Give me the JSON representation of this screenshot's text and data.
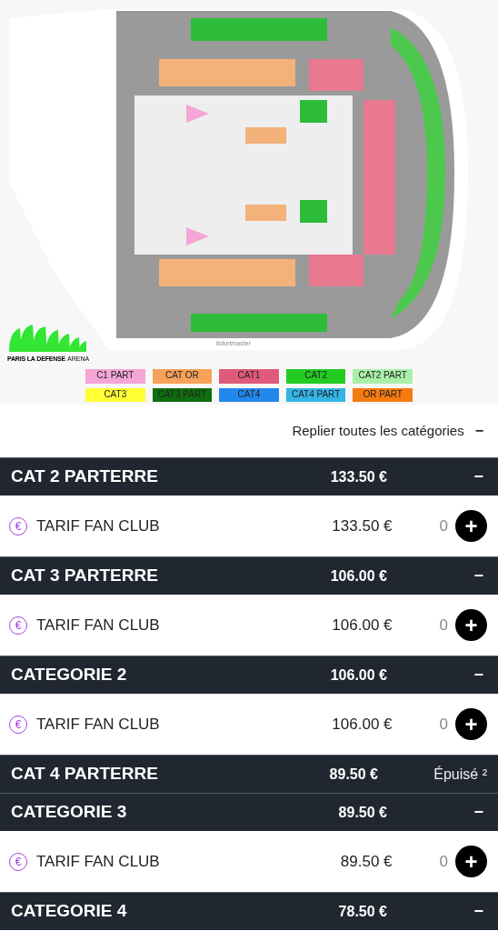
{
  "map": {
    "brand": "ticketmaster",
    "venue_logo": {
      "main": "PARIS LA DEFENSE",
      "accent": "ARENA"
    }
  },
  "legend": [
    {
      "label": "C1 PART",
      "color": "#f4a6d6"
    },
    {
      "label": "CAT OR",
      "color": "#f7a258"
    },
    {
      "label": "CAT1",
      "color": "#e05a7a"
    },
    {
      "label": "CAT2",
      "color": "#22cc22"
    },
    {
      "label": "CAT2 PART",
      "color": "#a8f0a8"
    },
    {
      "label": "CAT3",
      "color": "#ffff33"
    },
    {
      "label": "CAT3 PART",
      "color": "#0f6e0f"
    },
    {
      "label": "CAT4",
      "color": "#2288ee"
    },
    {
      "label": "CAT4 PART",
      "color": "#33b5e5"
    },
    {
      "label": "OR PART",
      "color": "#f57a10"
    }
  ],
  "collapse_all": {
    "label": "Replier toutes les catégories",
    "icon": "−"
  },
  "categories": [
    {
      "name": "CAT 2 PARTERRE",
      "price": "133.50 €",
      "expanded": true,
      "icon": "−",
      "tariffs": [
        {
          "icon": "€",
          "name": "TARIF FAN CLUB",
          "price": "133.50 €",
          "quantity": "0",
          "add": "+"
        }
      ]
    },
    {
      "name": "CAT 3 PARTERRE",
      "price": "106.00 €",
      "expanded": true,
      "icon": "−",
      "tariffs": [
        {
          "icon": "€",
          "name": "TARIF FAN CLUB",
          "price": "106.00 €",
          "quantity": "0",
          "add": "+"
        }
      ]
    },
    {
      "name": "CATEGORIE 2",
      "price": "106.00 €",
      "expanded": true,
      "icon": "−",
      "tariffs": [
        {
          "icon": "€",
          "name": "TARIF FAN CLUB",
          "price": "106.00 €",
          "quantity": "0",
          "add": "+"
        }
      ]
    },
    {
      "name": "CAT 4 PARTERRE",
      "price": "89.50 €",
      "expanded": false,
      "status": "Épuisé ²"
    },
    {
      "name": "CATEGORIE 3",
      "price": "89.50 €",
      "expanded": true,
      "icon": "−",
      "tariffs": [
        {
          "icon": "€",
          "name": "TARIF FAN CLUB",
          "price": "89.50 €",
          "quantity": "0",
          "add": "+"
        }
      ]
    },
    {
      "name": "CATEGORIE 4",
      "price": "78.50 €",
      "expanded": true,
      "icon": "−"
    }
  ]
}
